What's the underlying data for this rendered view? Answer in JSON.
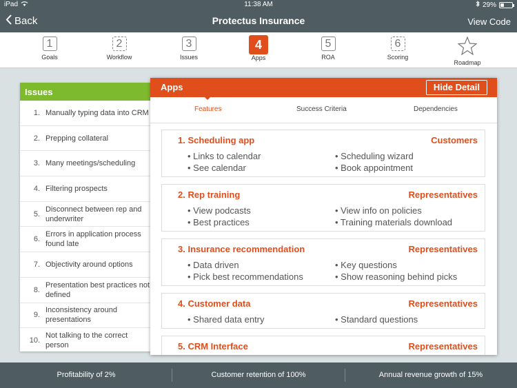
{
  "status": {
    "device": "iPad",
    "time": "11:38 AM",
    "battery": "29%"
  },
  "nav": {
    "back_label": "Back",
    "title": "Protectus Insurance",
    "view_code_label": "View Code"
  },
  "steps": [
    {
      "num": "1",
      "label": "Goals"
    },
    {
      "num": "2",
      "label": "Workflow"
    },
    {
      "num": "3",
      "label": "Issues"
    },
    {
      "num": "4",
      "label": "Apps"
    },
    {
      "num": "5",
      "label": "ROA"
    },
    {
      "num": "6",
      "label": "Scoring"
    },
    {
      "num": "",
      "label": "Roadmap"
    }
  ],
  "issues": {
    "title": "Issues",
    "items": [
      {
        "n": "1.",
        "text": "Manually typing data into CRM"
      },
      {
        "n": "2.",
        "text": "Prepping collateral"
      },
      {
        "n": "3.",
        "text": "Many meetings/scheduling"
      },
      {
        "n": "4.",
        "text": "Filtering prospects"
      },
      {
        "n": "5.",
        "text": "Disconnect between rep and underwriter"
      },
      {
        "n": "6.",
        "text": "Errors in application process found late"
      },
      {
        "n": "7.",
        "text": "Objectivity around options"
      },
      {
        "n": "8.",
        "text": "Presentation best practices not defined"
      },
      {
        "n": "9.",
        "text": "Inconsistency around presentations"
      },
      {
        "n": "10.",
        "text": "Not talking to the correct person"
      }
    ]
  },
  "apps": {
    "title": "Apps",
    "hide_detail_label": "Hide Detail",
    "tabs": [
      "Features",
      "Success Criteria",
      "Dependencies"
    ],
    "cards": [
      {
        "name": "1. Scheduling app",
        "audience": "Customers",
        "col1": [
          "• Links to calendar",
          "• See calendar"
        ],
        "col2": [
          "• Scheduling wizard",
          "• Book appointment"
        ]
      },
      {
        "name": "2. Rep training",
        "audience": "Representatives",
        "col1": [
          "• View podcasts",
          "• Best practices"
        ],
        "col2": [
          "• View info on policies",
          "• Training materials download"
        ]
      },
      {
        "name": "3. Insurance recommendation",
        "audience": "Representatives",
        "col1": [
          "• Data driven",
          "• Pick best recommendations"
        ],
        "col2": [
          "• Key questions",
          "• Show reasoning behind picks"
        ]
      },
      {
        "name": "4. Customer data",
        "audience": "Representatives",
        "col1": [
          "• Shared data entry"
        ],
        "col2": [
          "• Standard questions"
        ]
      },
      {
        "name": "5. CRM Interface",
        "audience": "Representatives",
        "col1": [],
        "col2": []
      }
    ]
  },
  "footer": {
    "items": [
      "Profitability of 2%",
      "Customer retention of 100%",
      "Annual revenue growth of 15%"
    ]
  },
  "colors": {
    "accent": "#e04e1b",
    "issues_header": "#7dba2d",
    "chrome": "#4f5d63"
  }
}
